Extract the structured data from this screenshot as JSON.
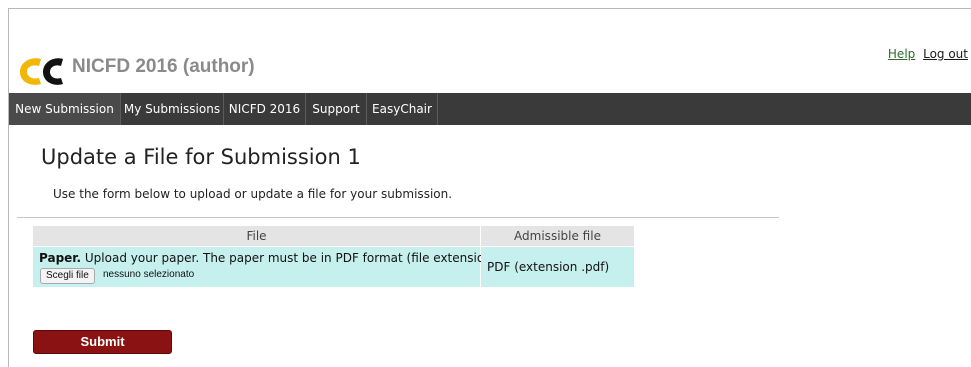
{
  "header": {
    "conference_title": "NICFD 2016 (author)",
    "links": {
      "help": "Help",
      "logout": "Log out"
    }
  },
  "menu": {
    "items": [
      {
        "label": "New Submission"
      },
      {
        "label": "My Submissions"
      },
      {
        "label": "NICFD 2016"
      },
      {
        "label": "Support"
      },
      {
        "label": "EasyChair"
      }
    ]
  },
  "page": {
    "title": "Update a File for Submission 1",
    "instructions": "Use the form below to upload or update a file for your submission."
  },
  "table": {
    "headers": [
      "File",
      "Admissible file extensions"
    ],
    "row": {
      "name": "Paper.",
      "description": " Upload your paper. The paper must be in PDF format (file extension .pdf)",
      "choose_button": "Scegli file",
      "file_status": "nessuno selezionato",
      "extensions": "PDF (extension .pdf)"
    }
  },
  "form": {
    "submit_label": "Submit"
  },
  "colors": {
    "menu_bg": "#3a3a3a",
    "row_bg": "#c6f0ee",
    "submit_bg": "#8b1212",
    "logo_yellow": "#f2b705",
    "logo_black": "#111111"
  },
  "icons": {
    "logo": "easychair-logo"
  }
}
